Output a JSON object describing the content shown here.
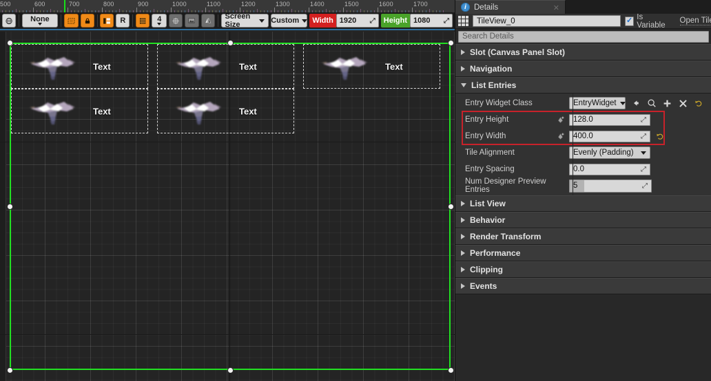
{
  "ruler": {
    "labels": [
      "500",
      "600",
      "700",
      "800",
      "900",
      "1000",
      "1100",
      "1200",
      "1300",
      "1400",
      "1500",
      "1600",
      "1700"
    ],
    "marker_color": "#18e018"
  },
  "toolbar": {
    "locale_icon": "globe-icon",
    "none_label": "None",
    "fill_screen_icon": "fill-screen-icon",
    "lock_icon": "lock-icon",
    "layout_icon": "layout-icon",
    "r_label": "R",
    "grid_icon": "grid-icon",
    "grid_snap_value": "4",
    "center_icon": "center-icon",
    "image_icon": "image-icon",
    "mirror_icon": "mirror-icon",
    "screen_size_label": "Screen Size",
    "custom_label": "Custom",
    "width_label": "Width",
    "width_value": "1920",
    "height_label": "Height",
    "height_value": "1080",
    "width_tag_color": "#d32020",
    "height_tag_color": "#4aa32a"
  },
  "canvas": {
    "selection_color": "#22e022",
    "tiles": [
      {
        "label": "Text"
      },
      {
        "label": "Text"
      },
      {
        "label": "Text"
      },
      {
        "label": "Text"
      },
      {
        "label": "Text"
      }
    ]
  },
  "details": {
    "tab_label": "Details",
    "tab_icon": "info-icon",
    "close_icon": "close-icon",
    "widget_icon": "tileview-icon",
    "name_value": "TileView_0",
    "is_variable_label": "Is Variable",
    "is_variable_checked": true,
    "open_tile_label": "Open Tile",
    "search_placeholder": "Search Details",
    "categories_top": [
      {
        "label": "Slot (Canvas Panel Slot)",
        "open": false
      },
      {
        "label": "Navigation",
        "open": false
      }
    ],
    "list_entries": {
      "label": "List Entries",
      "open": true,
      "rows": [
        {
          "name": "Entry Widget Class",
          "type": "class-picker",
          "value": "EntryWidget",
          "icons": [
            "back-arrow-icon",
            "browse-icon",
            "plus-icon",
            "clear-icon",
            "reset-icon"
          ]
        },
        {
          "name": "Entry Height",
          "type": "number",
          "value": "128.0",
          "bindable": true,
          "highlighted": true
        },
        {
          "name": "Entry Width",
          "type": "number",
          "value": "400.0",
          "bindable": true,
          "highlighted": true,
          "has_reset": true
        },
        {
          "name": "Tile Alignment",
          "type": "dropdown",
          "value": "Evenly (Padding)"
        },
        {
          "name": "Entry Spacing",
          "type": "number",
          "value": "0.0"
        },
        {
          "name": "Num Designer Preview Entries",
          "type": "slider",
          "value": "5",
          "fill_percent": 18
        }
      ]
    },
    "categories_bottom": [
      {
        "label": "List View",
        "open": false
      },
      {
        "label": "Behavior",
        "open": false
      },
      {
        "label": "Render Transform",
        "open": false
      },
      {
        "label": "Performance",
        "open": false
      },
      {
        "label": "Clipping",
        "open": false
      },
      {
        "label": "Events",
        "open": false
      }
    ],
    "highlight_color": "#c8222a"
  }
}
